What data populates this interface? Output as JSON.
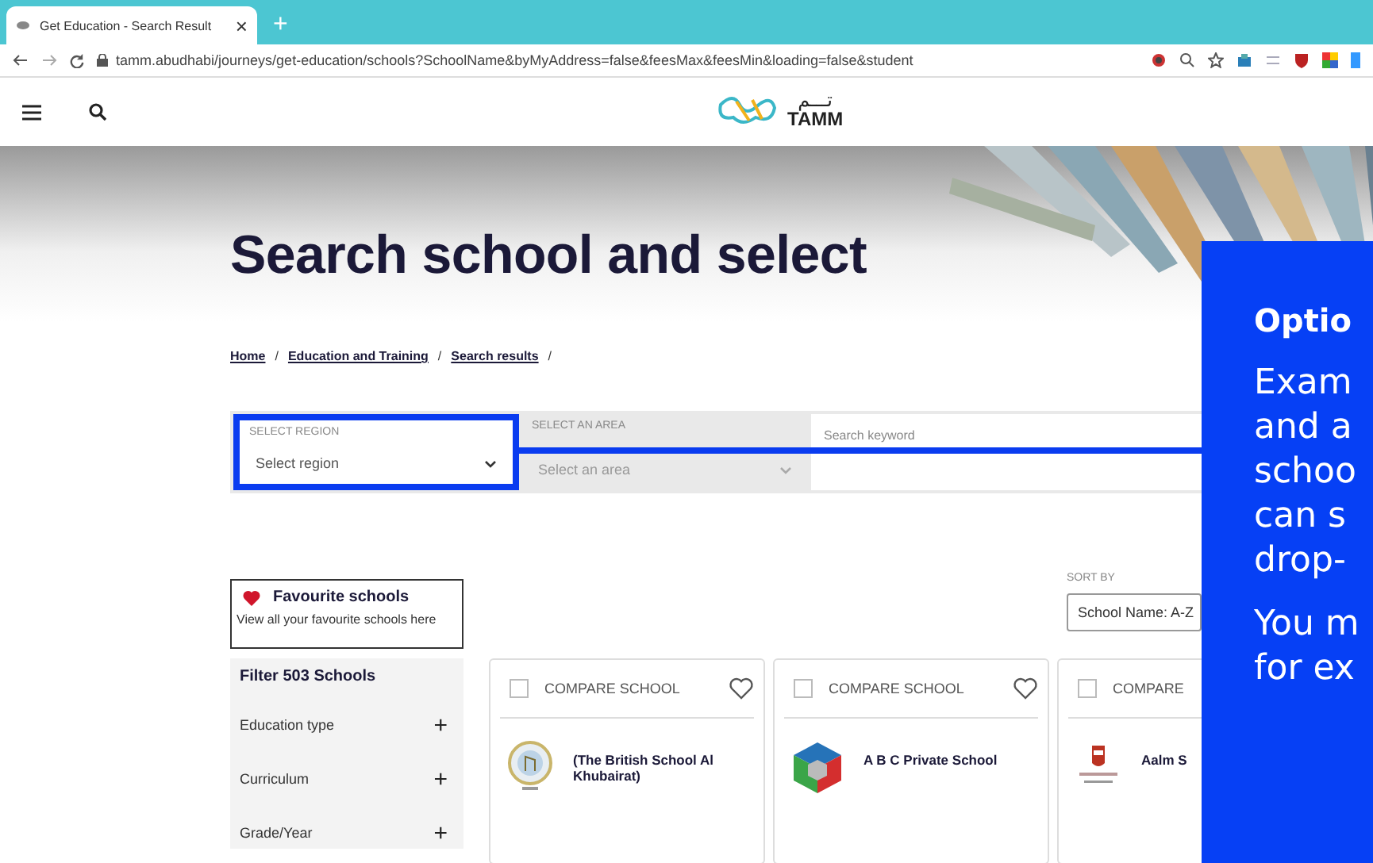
{
  "browser": {
    "tab_title": "Get Education - Search Result",
    "tab_close": "×",
    "new_tab": "+",
    "url": "tamm.abudhabi/journeys/get-education/schools?SchoolName&byMyAddress=false&feesMax&feesMin&loading=false&student"
  },
  "header": {
    "logo_arabic": "تـــم",
    "logo_text": "TAMM"
  },
  "hero": {
    "title": "Search school and select"
  },
  "breadcrumb": [
    {
      "label": "Home",
      "separator": "/"
    },
    {
      "label": "Education and Training",
      "separator": "/"
    },
    {
      "label": "Search results",
      "separator": "/"
    }
  ],
  "filters": [
    {
      "kind": "select",
      "label": "SELECT REGION",
      "value": "Select region",
      "highlighted": true,
      "disabled": false
    },
    {
      "kind": "select",
      "label": "SELECT AN AREA",
      "value": "Select an area",
      "highlighted": false,
      "disabled": true
    },
    {
      "kind": "search",
      "placeholder": "Search keyword"
    }
  ],
  "favourites": {
    "title": "Favourite schools",
    "subtitle": "View all your favourite schools here"
  },
  "sort": {
    "label": "SORT BY",
    "value": "School Name: A-Z"
  },
  "filter_panel": {
    "title": "Filter 503 Schools",
    "groups": [
      {
        "label": "Education type",
        "toggle": "+"
      },
      {
        "label": "Curriculum",
        "toggle": "+"
      },
      {
        "label": "Grade/Year",
        "toggle": "+"
      }
    ]
  },
  "cards": [
    {
      "compare": "COMPARE SCHOOL",
      "checked": false,
      "favourite": false,
      "name": "(The British School Al Khubairat)",
      "kind": "crest"
    },
    {
      "compare": "COMPARE SCHOOL",
      "checked": false,
      "favourite": false,
      "name": "A B C Private School",
      "kind": "cube"
    },
    {
      "compare": "COMPARE",
      "checked": false,
      "name": "Aalm S",
      "kind": "emblem"
    }
  ],
  "callout": {
    "title": "Optio",
    "paragraphs": [
      [
        "Exam",
        "and a",
        "schoo",
        "can s",
        "drop-"
      ],
      [
        "You m",
        "for ex"
      ]
    ]
  }
}
